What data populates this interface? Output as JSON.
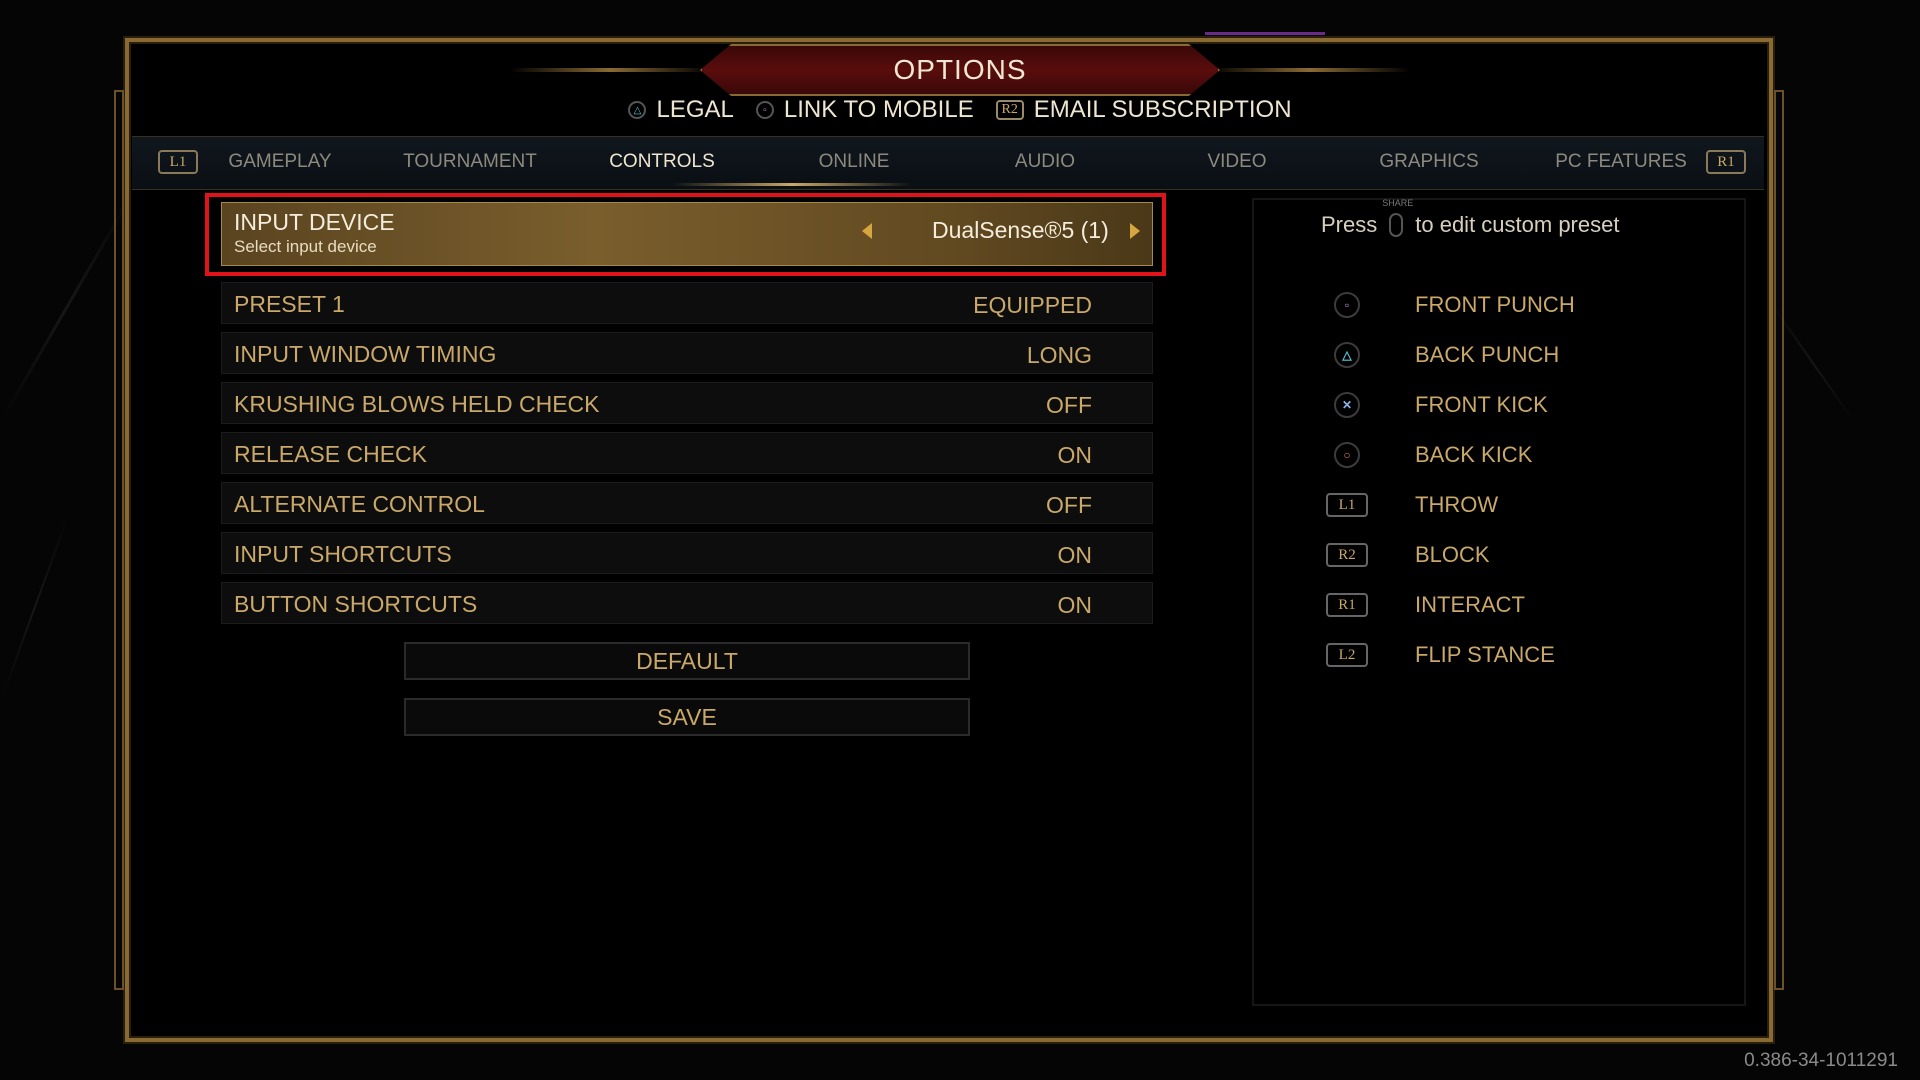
{
  "header": {
    "title": "OPTIONS",
    "links": [
      {
        "glyph": "triangle",
        "label": "LEGAL"
      },
      {
        "glyph": "square",
        "label": "LINK TO MOBILE"
      },
      {
        "glyph": "R2",
        "label": "EMAIL SUBSCRIPTION"
      }
    ]
  },
  "tabs": {
    "left_bumper": "L1",
    "right_bumper": "R1",
    "items": [
      "GAMEPLAY",
      "TOURNAMENT",
      "CONTROLS",
      "ONLINE",
      "AUDIO",
      "VIDEO",
      "GRAPHICS",
      "PC FEATURES"
    ],
    "active": "CONTROLS"
  },
  "input_device": {
    "title": "INPUT DEVICE",
    "subtitle": "Select input device",
    "value": "DualSense®5 (1)"
  },
  "settings": [
    {
      "label": "PRESET 1",
      "value": "EQUIPPED"
    },
    {
      "label": "INPUT WINDOW TIMING",
      "value": "LONG"
    },
    {
      "label": "KRUSHING BLOWS HELD CHECK",
      "value": "OFF"
    },
    {
      "label": "RELEASE CHECK",
      "value": "ON"
    },
    {
      "label": "ALTERNATE CONTROL",
      "value": "OFF"
    },
    {
      "label": "INPUT SHORTCUTS",
      "value": "ON"
    },
    {
      "label": "BUTTON SHORTCUTS",
      "value": "ON"
    }
  ],
  "buttons": {
    "default": "DEFAULT",
    "save": "SAVE"
  },
  "preset_panel": {
    "press": "Press",
    "share_label": "SHARE",
    "hint": "to edit custom preset",
    "mappings": [
      {
        "button": "square",
        "glyph": "▫",
        "color": "#c58ad6",
        "action": "FRONT PUNCH"
      },
      {
        "button": "triangle",
        "glyph": "△",
        "color": "#52c7d9",
        "action": "BACK PUNCH"
      },
      {
        "button": "cross",
        "glyph": "✕",
        "color": "#8ab4e8",
        "action": "FRONT KICK"
      },
      {
        "button": "circle",
        "glyph": "○",
        "color": "#e07a7a",
        "action": "BACK KICK"
      },
      {
        "button": "L1",
        "glyph": "L1",
        "color": "#c9a86a",
        "action": "THROW"
      },
      {
        "button": "R2",
        "glyph": "R2",
        "color": "#c9a86a",
        "action": "BLOCK"
      },
      {
        "button": "R1",
        "glyph": "R1",
        "color": "#c9a86a",
        "action": "INTERACT"
      },
      {
        "button": "L2",
        "glyph": "L2",
        "color": "#c9a86a",
        "action": "FLIP STANCE"
      }
    ]
  },
  "version": "0.386-34-1011291",
  "colors": {
    "gold": "#c9a86a",
    "highlight_red": "#e0121a",
    "title_red": "#5a0d0d"
  }
}
